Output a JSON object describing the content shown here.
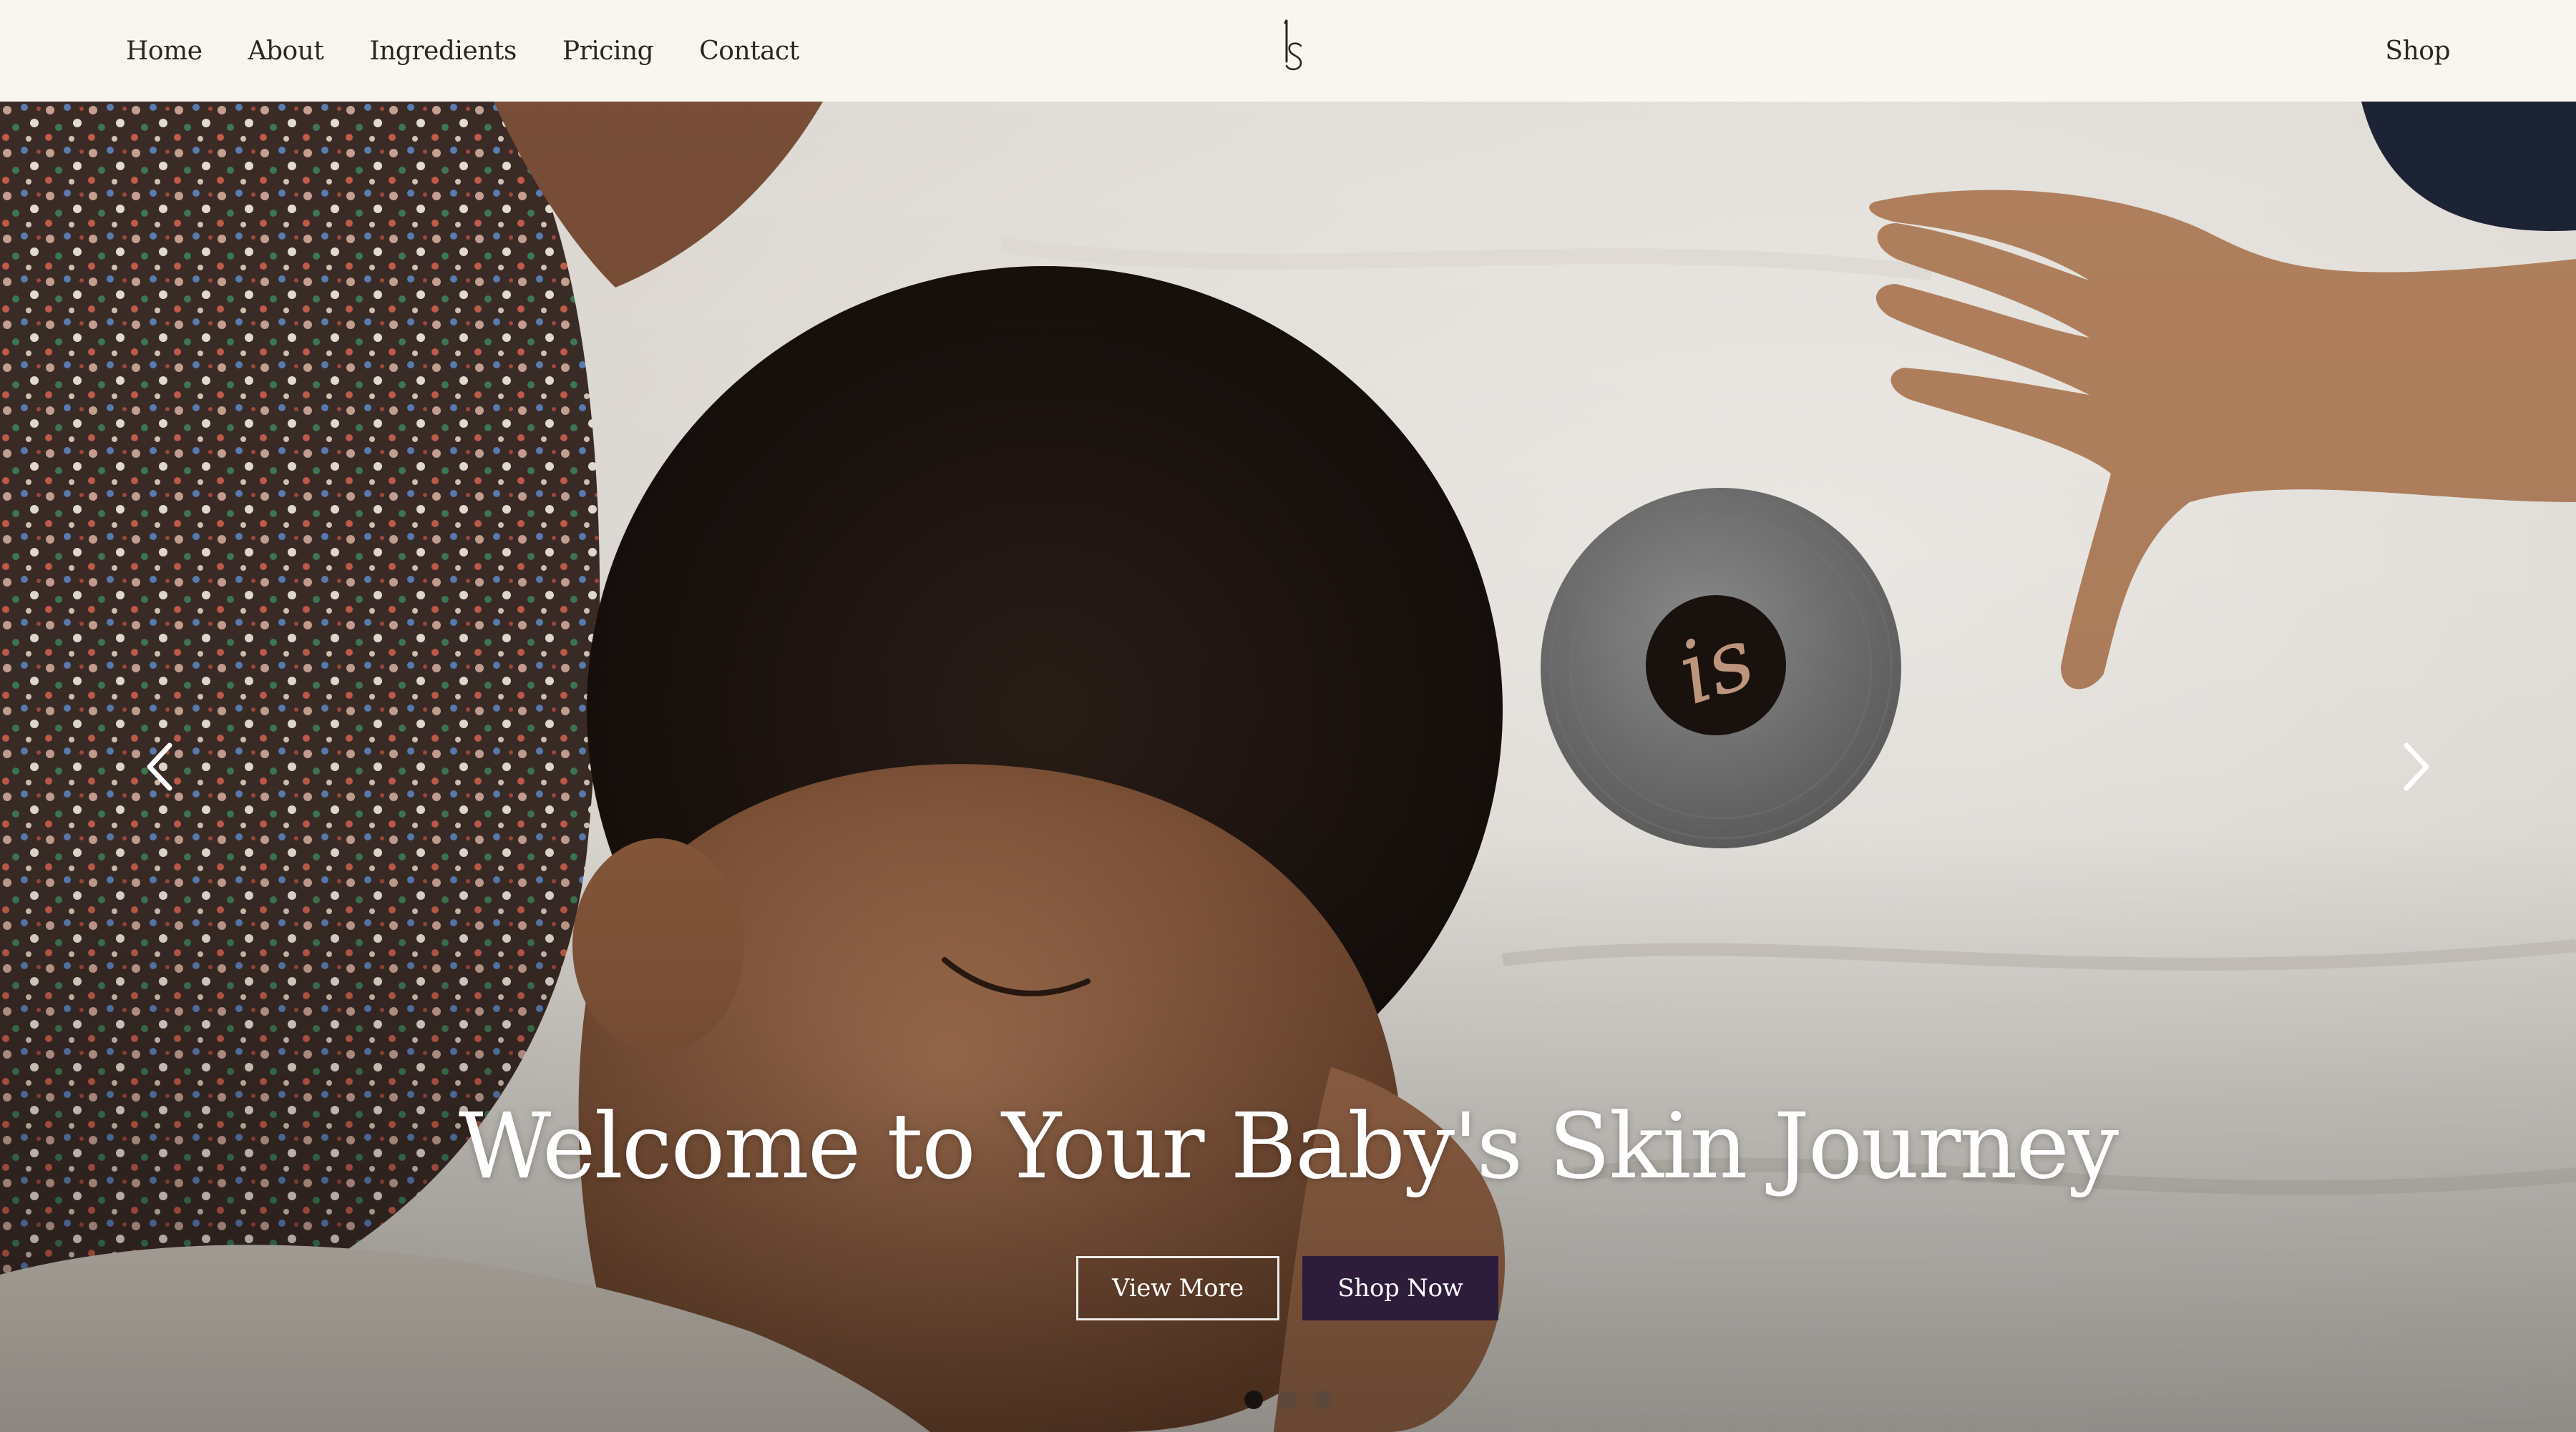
{
  "nav": {
    "links": [
      {
        "label": "Home"
      },
      {
        "label": "About"
      },
      {
        "label": "Ingredients"
      },
      {
        "label": "Pricing"
      },
      {
        "label": "Contact"
      }
    ],
    "logo_icon": "is-monogram-logo",
    "shop_label": "Shop"
  },
  "hero": {
    "headline": "Welcome to Your Baby's Skin Journey",
    "buttons": {
      "view_more": "View More",
      "shop_now": "Shop Now"
    },
    "carousel": {
      "prev_icon": "chevron-left-icon",
      "next_icon": "chevron-right-icon",
      "slide_count": 3,
      "active_slide": 1
    }
  },
  "colors": {
    "nav_background": "#f9f6f0",
    "nav_text": "#2b2622",
    "shop_button": "#2d1d3b",
    "text_on_image": "#ffffff"
  }
}
